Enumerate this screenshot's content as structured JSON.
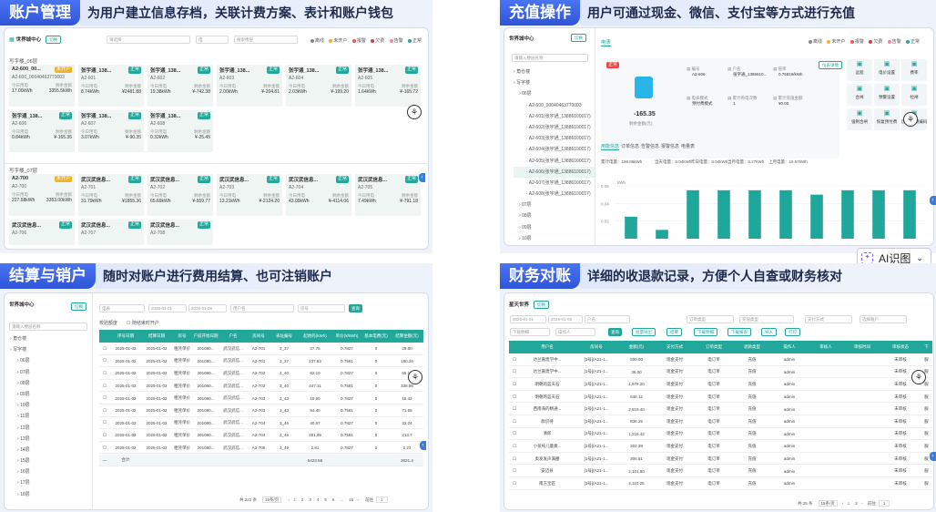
{
  "q1": {
    "title": "账户管理",
    "desc": "为用户建立信息存档，关联计费方案、表计和账户钱包",
    "app": "世界城中心",
    "app_btn": "切换",
    "filters": [
      "请选择",
      "电",
      "搜索楼层"
    ],
    "legend": [
      "离线",
      "未开户",
      "报警",
      "欠费",
      "告警",
      "正常"
    ],
    "floor1": "写字楼_06层",
    "floor2": "写字楼_07层",
    "cards": [
      {
        "name": "A2-600_00...",
        "id": "A2-600_00040463770003",
        "tag": "未开户",
        "tc": "o",
        "l1": "今日用电",
        "l2": "剩余金额",
        "v1": "17.00kWh",
        "v2": "3355.5kWh"
      },
      {
        "name": "张宇通_138...",
        "id": "A2-601",
        "tag": "正常",
        "tc": "g",
        "l1": "今日用电",
        "l2": "剩余金额",
        "v1": "8.74kWh",
        "v2": "¥2481.88"
      },
      {
        "name": "张宇通_138...",
        "id": "A2-602",
        "tag": "正常",
        "tc": "g",
        "l1": "今日用电",
        "l2": "剩余金额",
        "v1": "19.38kWh",
        "v2": "¥-742.38"
      },
      {
        "name": "张宇通_138...",
        "id": "A2-603",
        "tag": "正常",
        "tc": "g",
        "l1": "今日用电",
        "l2": "剩余金额",
        "v1": "2.00kWh",
        "v2": "¥-204.81"
      },
      {
        "name": "张宇通_138...",
        "id": "A2-604",
        "tag": "正常",
        "tc": "g",
        "l1": "今日用电",
        "l2": "剩余金额",
        "v1": "2.03kWh",
        "v2": "¥-199.20"
      },
      {
        "name": "张宇通_138...",
        "id": "A2-605",
        "tag": "正常",
        "tc": "g",
        "l1": "今日用电",
        "l2": "剩余金额",
        "v1": "1.64kWh",
        "v2": "¥-165.72"
      },
      {
        "name": "张宇通_138...",
        "id": "A2-606",
        "tag": "正常",
        "tc": "g",
        "l1": "今日用电",
        "l2": "剩余金额",
        "v1": "0.84kWh",
        "v2": "¥-165.35"
      },
      {
        "name": "张宇通_138...",
        "id": "A2-607",
        "tag": "正常",
        "tc": "g",
        "l1": "今日用电",
        "l2": "剩余金额",
        "v1": "3.07kWh",
        "v2": "¥-90.35"
      },
      {
        "name": "张宇通_138...",
        "id": "A2-608",
        "tag": "正常",
        "tc": "g",
        "l1": "今日用电",
        "l2": "剩余金额",
        "v1": "0.32kWh",
        "v2": "¥-25.45"
      },
      {
        "name": "A2-700",
        "id": "A2-700",
        "tag": "未开户",
        "tc": "o",
        "l1": "今日用电",
        "l2": "剩余金额",
        "v1": "227.58kWh",
        "v2": "3353.00kWh"
      },
      {
        "name": "武汉武信息...",
        "id": "A2-701",
        "tag": "正常",
        "tc": "g",
        "l1": "今日用电",
        "l2": "剩余金额",
        "v1": "31.79kWh",
        "v2": "¥1855.36"
      },
      {
        "name": "武汉武信息...",
        "id": "A2-702",
        "tag": "正常",
        "tc": "g",
        "l1": "今日用电",
        "l2": "剩余金额",
        "v1": "65.69kWh",
        "v2": "¥-559.77"
      },
      {
        "name": "武汉武信息...",
        "id": "A2-703",
        "tag": "正常",
        "tc": "g",
        "l1": "今日用电",
        "l2": "剩余金额",
        "v1": "13.21kWh",
        "v2": "¥-2124.20"
      },
      {
        "name": "武汉武信息...",
        "id": "A2-704",
        "tag": "正常",
        "tc": "g",
        "l1": "今日用电",
        "l2": "剩余金额",
        "v1": "43.09kWh",
        "v2": "¥-4114.06"
      },
      {
        "name": "武汉武信息...",
        "id": "A2-705",
        "tag": "正常",
        "tc": "g",
        "l1": "今日用电",
        "l2": "剩余金额",
        "v1": "7.49kWh",
        "v2": "¥-791.18"
      },
      {
        "name": "武汉武信息...",
        "id": "A2-706",
        "tag": "正常",
        "tc": "g",
        "l1": "",
        "l2": "",
        "v1": "",
        "v2": ""
      },
      {
        "name": "武汉武信息...",
        "id": "A2-707",
        "tag": "正常",
        "tc": "g",
        "l1": "",
        "l2": "",
        "v1": "",
        "v2": ""
      },
      {
        "name": "武汉武信息...",
        "id": "A2-708",
        "tag": "正常",
        "tc": "g",
        "l1": "",
        "l2": "",
        "v1": "",
        "v2": ""
      }
    ]
  },
  "q2": {
    "title": "充值操作",
    "desc": "用户可通过现金、微信、支付宝等方式进行充值",
    "app": "世界城中心",
    "app_btn": "切换",
    "search": "请输入楼层名称",
    "tree": [
      "角仓楼",
      "写字楼",
      "06层",
      "A2-600_00040463770003",
      "A2-601(张宇通_13886100017)",
      "A2-602(张宇通_13886100017)",
      "A2-603(张宇通_13886100017)",
      "A2-604(张宇通_13886100017)",
      "A2-605(张宇通_13886100017)",
      "A2-606(张宇通_13886100017)",
      "A2-607(张宇通_13886100017)",
      "A2-608(张宇通_13886100017)",
      "07层",
      "08层",
      "09层",
      "10层"
    ],
    "tab": "电表",
    "legend": [
      "离线",
      "未开户",
      "报警",
      "欠费",
      "告警",
      "正常"
    ],
    "status": "正常",
    "balance": "-165.35",
    "balance_label": "剩余金额(元)",
    "info": [
      {
        "k": "编号",
        "v": "A2-606"
      },
      {
        "k": "户名",
        "v": "张宇通_1386610..."
      },
      {
        "k": "倍率",
        "v": "0.7581¥/kWh"
      },
      {
        "k": "电表模式",
        "v": "预付费模式"
      },
      {
        "k": "累计购电次数",
        "v": "1"
      },
      {
        "k": "累计充值金额",
        "v": "¥0.00"
      }
    ],
    "detail_btn": "仪表详情",
    "actions": [
      "远程",
      "电价设置",
      "费率",
      "合闸",
      "预警设置",
      "拉闸",
      "强制合闸",
      "恢复预付费",
      "历史/回溯编码"
    ],
    "subtabs": [
      "用能信息",
      "订单信息",
      "告警信息",
      "报警信息",
      "电量表"
    ],
    "stats": [
      "累计电量：198.86kWh",
      "当天电量：0.04kWh",
      "昨日电量：0.04kWh",
      "当月电量：0.27kWh",
      "上月电量：16.57kWh"
    ],
    "unit": "kWh",
    "chart_data": {
      "type": "bar",
      "ylabel": "kWh",
      "yticks": [
        "0.06",
        "0.04",
        "0.02"
      ],
      "ylim": [
        0,
        0.06
      ],
      "values": [
        0.025,
        0.01,
        0.055,
        0.055,
        0.055,
        0.055,
        0.05,
        0.055,
        0.055,
        0.055
      ]
    }
  },
  "q3": {
    "title": "结算与销户",
    "desc": "随时对账户进行费用结算、也可注销账户",
    "app": "世界城中心",
    "app_btn": "切换",
    "search": "请输入楼层名称",
    "tree": [
      "角仓楼",
      "写字楼",
      "06层",
      "07层",
      "08层",
      "09层",
      "10层",
      "11层",
      "12层",
      "13层",
      "14层",
      "15层",
      "16层",
      "17层",
      "18层"
    ],
    "filters": [
      "电表",
      "2025-01-01",
      "2025-01-08",
      "用户名",
      "房号"
    ],
    "search_btn": "查询",
    "checks": [
      "校验额度",
      "随结束时开户"
    ],
    "headers": [
      "",
      "序号日期",
      "结算日期",
      "房号",
      "户前开始日期",
      "户名",
      "房间号",
      "表址编号",
      "起始码(kWh)",
      "单价(¥/kWh)",
      "基本电费(元)",
      "结算金额(元)"
    ],
    "rows": [
      [
        "",
        "2025-01-02",
        "2025-01-02",
        "租凭单价",
        "201080...",
        "武汉武信...",
        "A2-701",
        "3_37",
        "37.75",
        "0.7827",
        "0",
        "29.80"
      ],
      [
        "",
        "2025-01-02",
        "2025-01-02",
        "租凭单价",
        "201080...",
        "武汉武信...",
        "A2-701",
        "3_37",
        "237.83",
        "0.7581",
        "0",
        "180.26"
      ],
      [
        "",
        "2025-01-02",
        "2025-01-02",
        "租凭单价",
        "201080...",
        "武汉武信...",
        "A2-702",
        "3_40",
        "82.10",
        "0.7827",
        "0",
        "65.13"
      ],
      [
        "",
        "2025-01-02",
        "2025-01-02",
        "租凭单价",
        "201080...",
        "武汉武信...",
        "A2-702",
        "3_40",
        "447.11",
        "0.7581",
        "0",
        "338.96"
      ],
      [
        "",
        "2025-01-02",
        "2025-01-02",
        "租凭单价",
        "201080...",
        "武汉武信...",
        "A2-703",
        "3_43",
        "19.60",
        "0.7827",
        "0",
        "15.42"
      ],
      [
        "",
        "2025-01-02",
        "2025-01-02",
        "租凭单价",
        "201080...",
        "武汉武信...",
        "A2-703",
        "3_43",
        "94.40",
        "0.7581",
        "0",
        "71.55"
      ],
      [
        "",
        "2025-01-02",
        "2025-01-02",
        "租凭单价",
        "201080...",
        "武汉武信...",
        "A2-704",
        "3_46",
        "40.67",
        "0.7827",
        "0",
        "32.24"
      ],
      [
        "",
        "2025-01-02",
        "2025-01-02",
        "租凭单价",
        "201080...",
        "武汉武信...",
        "A2-704",
        "3_46",
        "281.89",
        "0.7581",
        "0",
        "213.7"
      ],
      [
        "",
        "2025-01-02",
        "2025-01-02",
        "租凭单价",
        "201080...",
        "武汉武信...",
        "A2-705",
        "3_49",
        "2.81",
        "0.7827",
        "0",
        "2.23"
      ]
    ],
    "total": [
      "—",
      "合计",
      "",
      "",
      "",
      "",
      "",
      "",
      "5423.56",
      "",
      "",
      "2021.4"
    ],
    "pager": {
      "total": "共 222 条",
      "size": "15条/页",
      "pages": [
        "1",
        "2",
        "3",
        "4",
        "5",
        "6",
        "...",
        "15"
      ],
      "goto": "前往",
      "page": "1"
    }
  },
  "q4": {
    "title": "财务对账",
    "desc": "详细的收退款记录，方便个人自查或财务核对",
    "app": "星天世界",
    "app_btn": "切换",
    "filters": [
      "2025-01-01",
      "2025-01-08",
      "户名",
      "订单类型",
      "充值类型",
      "支付方式",
      "选择账户"
    ],
    "filters2": [
      "下级明细",
      "操作人"
    ],
    "buttons": [
      "查询",
      "批量导出",
      "结算",
      "下载明细",
      "下载报表",
      "导入",
      "打印"
    ],
    "headers": [
      "",
      "用户名",
      "房间号",
      "金额(元)",
      "支付方式",
      "订单类型",
      "退款类型",
      "操作人",
      "审核人",
      "审核时间",
      "审核状态",
      "下"
    ],
    "rows": [
      [
        "",
        "达兰嘉煌学中...",
        "[1号](A21-1...",
        "500.00",
        "现金支付",
        "电订单",
        "充值",
        "admin",
        "",
        "",
        "未审核",
        "服"
      ],
      [
        "",
        "达兰嘉煌学中...",
        "[1号](A21-1...",
        "36.00",
        "现金支付",
        "电订单",
        "充值",
        "admin",
        "",
        "",
        "未审核",
        "服"
      ],
      [
        "",
        "明朝的蓝天石",
        "[1号](A21-1...",
        "1,879.20",
        "现金支付",
        "电订单",
        "充值",
        "admin",
        "",
        "",
        "未审核",
        "服"
      ],
      [
        "",
        "明朝的蓝天石",
        "[1号](A21-1...",
        "648.12",
        "现金支付",
        "电订单",
        "充值",
        "admin",
        "",
        "",
        "未审核",
        "服"
      ],
      [
        "",
        "西南海的精通...",
        "[1号](A21-1...",
        "2,819.40",
        "现金支付",
        "电订单",
        "充值",
        "admin",
        "",
        "",
        "未审核",
        "服"
      ],
      [
        "",
        "款识待",
        "[1号](A21-1...",
        "836.25",
        "现金支付",
        "电订单",
        "充值",
        "admin",
        "",
        "",
        "未审核",
        "服"
      ],
      [
        "",
        "清郎",
        "[1号](A21-1...",
        "1,218.42",
        "现金支付",
        "电订单",
        "充值",
        "admin",
        "",
        "",
        "未审核",
        "服"
      ],
      [
        "",
        "小孩纯儿童素...",
        "[1号](A21-1...",
        "302.39",
        "现金支付",
        "电订单",
        "充值",
        "admin",
        "",
        "",
        "未审核",
        "服"
      ],
      [
        "",
        "奥发发声满腰",
        "[1号](A21-1...",
        "306.51",
        "现金支付",
        "电订单",
        "充值",
        "admin",
        "",
        "",
        "未审核",
        "服"
      ],
      [
        "",
        "安迈县",
        "[1号](A21-1...",
        "2,101.90",
        "现金支付",
        "电订单",
        "充值",
        "admin",
        "",
        "",
        "未审核",
        "服"
      ],
      [
        "",
        "南方宝匠",
        "[1号](A21-1...",
        "2,110.25",
        "现金支付",
        "电订单",
        "充值",
        "admin",
        "",
        "",
        "未审核",
        "服"
      ]
    ],
    "pager": {
      "total": "共 25 条",
      "size": "15条/页",
      "pages": [
        "1",
        "2"
      ],
      "goto": "前往",
      "page": "1"
    }
  },
  "ai": {
    "label": "AI识图"
  },
  "colors": {
    "brand": "#2f55d8",
    "teal": "#22a89a",
    "orange": "#f0b42a"
  }
}
